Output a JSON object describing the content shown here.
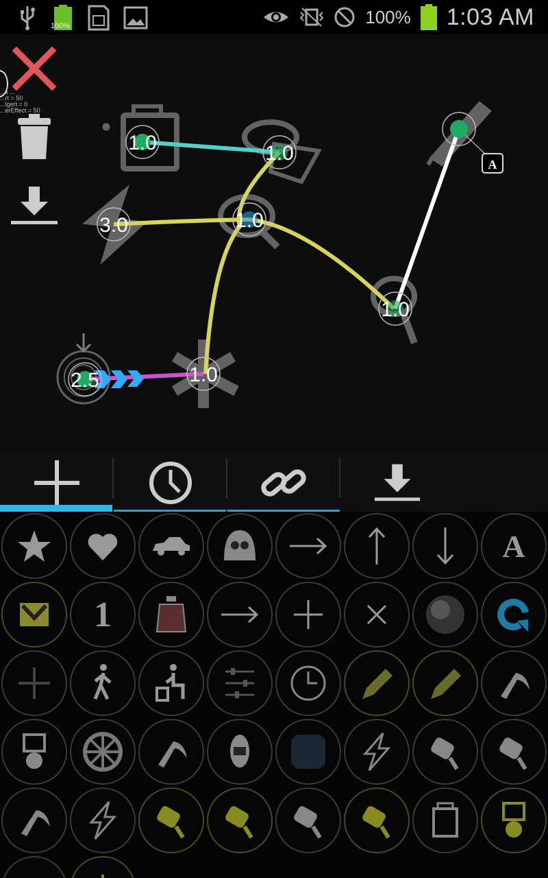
{
  "status_bar": {
    "battery_badge": "100%",
    "battery_percent": "100%",
    "time": "1:03 AM",
    "icons": [
      "usb-icon",
      "battery-full-icon",
      "sd-card-icon",
      "image-icon",
      "eye-icon",
      "vibrate-off-icon",
      "no-signal-icon",
      "battery-icon"
    ]
  },
  "canvas": {
    "debug_lines": [
      "...x ...",
      "...rt = 50",
      "...lgert = 0",
      "...erEffect = 50"
    ],
    "nodes": [
      {
        "id": "n1",
        "label": "1.0",
        "icon": "paint-bucket"
      },
      {
        "id": "n2",
        "label": "1.0",
        "icon": "rotor"
      },
      {
        "id": "n3",
        "label": "3.0",
        "icon": "lightning"
      },
      {
        "id": "n4",
        "label": "1.0",
        "icon": "motor"
      },
      {
        "id": "n5",
        "label": "1.0",
        "icon": "motor"
      },
      {
        "id": "n6",
        "label": "1.0",
        "icon": "fan"
      },
      {
        "id": "n7",
        "label": "2.5",
        "icon": "spin"
      },
      {
        "id": "n8",
        "label": "",
        "icon": "pencil"
      }
    ],
    "links": [
      {
        "from": "n1",
        "to": "n2",
        "color": "#4fd1c5"
      },
      {
        "from": "n3",
        "to": "n4",
        "color": "#d6d35e"
      },
      {
        "from": "n2",
        "to": "n4",
        "color": "#d6d35e"
      },
      {
        "from": "n4",
        "to": "n5",
        "color": "#d6d35e"
      },
      {
        "from": "n4",
        "to": "n6",
        "color": "#d6d35e"
      },
      {
        "from": "n7",
        "to": "n6",
        "color": "#cc55cc"
      },
      {
        "from": "n8",
        "to": "n5",
        "color": "#ffffff"
      }
    ],
    "badge_label": "A",
    "colors": {
      "accent": "#33b5e5",
      "node_dot": "#1faa66",
      "line_yellow": "#d6d35e",
      "line_cyan": "#4fd1c5",
      "line_pink": "#cc55cc",
      "arrow_blue": "#33aaff"
    }
  },
  "side_tools": [
    {
      "name": "close",
      "icon": "close-icon"
    },
    {
      "name": "delete",
      "icon": "trash-icon"
    },
    {
      "name": "download",
      "icon": "download-icon"
    }
  ],
  "tabs": [
    {
      "name": "add",
      "icon": "plus-icon",
      "active": true
    },
    {
      "name": "time",
      "icon": "clock-icon",
      "active": false
    },
    {
      "name": "link",
      "icon": "link-icon",
      "active": false
    },
    {
      "name": "save",
      "icon": "download-icon",
      "active": false
    }
  ],
  "palette": {
    "rows": [
      [
        {
          "icon": "star-icon"
        },
        {
          "icon": "heart-icon"
        },
        {
          "icon": "car-icon"
        },
        {
          "icon": "pou-icon"
        },
        {
          "icon": "arrow-right-icon"
        },
        {
          "icon": "arrow-up-icon"
        },
        {
          "icon": "arrow-down-icon"
        },
        {
          "icon": "letter-a-icon",
          "text": "A"
        }
      ],
      [
        {
          "icon": "logo-m-icon",
          "sel": true
        },
        {
          "icon": "number-one-icon",
          "text": "1"
        },
        {
          "icon": "bottle-icon"
        },
        {
          "icon": "arrow-right-icon"
        },
        {
          "icon": "plus-icon"
        },
        {
          "icon": "multiply-icon"
        },
        {
          "icon": "dark-sphere-icon"
        },
        {
          "icon": "refresh-icon"
        }
      ],
      [
        {
          "icon": "plus-dim-icon"
        },
        {
          "icon": "walking-icon"
        },
        {
          "icon": "sitting-icon"
        },
        {
          "icon": "sliders-icon"
        },
        {
          "icon": "clock-icon"
        },
        {
          "icon": "pencil-icon",
          "sel": true
        },
        {
          "icon": "pencil-icon",
          "sel": true
        },
        {
          "icon": "pickaxe-icon"
        }
      ],
      [
        {
          "icon": "piston-icon"
        },
        {
          "icon": "wheel-icon"
        },
        {
          "icon": "pickaxe-icon"
        },
        {
          "icon": "robot-icon"
        },
        {
          "icon": "panel-icon"
        },
        {
          "icon": "lightning-icon"
        },
        {
          "icon": "motor-icon"
        },
        {
          "icon": "motor-icon"
        }
      ],
      [
        {
          "icon": "pickaxe-icon"
        },
        {
          "icon": "lightning-icon"
        },
        {
          "icon": "motor-yellow-icon",
          "sel": true
        },
        {
          "icon": "motor-yellow-icon",
          "sel": true
        },
        {
          "icon": "motor-icon"
        },
        {
          "icon": "motor-yellow-icon",
          "sel": true
        },
        {
          "icon": "paint-bucket-icon"
        },
        {
          "icon": "piston-yellow-icon",
          "sel": true
        }
      ],
      [
        {
          "icon": "sparkle-icon"
        },
        {
          "icon": "sun-icon",
          "sel": true
        }
      ]
    ]
  }
}
